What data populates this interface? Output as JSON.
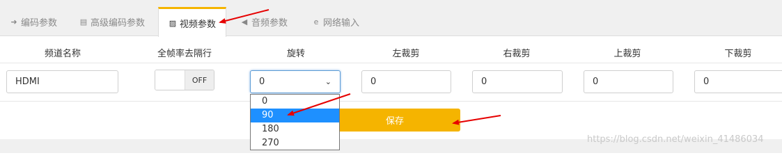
{
  "tabs": [
    {
      "label": "编码参数",
      "icon": "sign-in-icon",
      "glyph": "➜",
      "active": false
    },
    {
      "label": "高级编码参数",
      "icon": "file-icon",
      "glyph": "▤",
      "active": false
    },
    {
      "label": "视频参数",
      "icon": "image-icon",
      "glyph": "▨",
      "active": true
    },
    {
      "label": "音频参数",
      "icon": "volume-icon",
      "glyph": "◀",
      "active": false
    },
    {
      "label": "网络输入",
      "icon": "ie-icon",
      "glyph": "e",
      "active": false
    }
  ],
  "columns": {
    "channel_name": "频道名称",
    "deinterlace": "全帧率去隔行",
    "rotate": "旋转",
    "crop_left": "左裁剪",
    "crop_right": "右裁剪",
    "crop_top": "上裁剪",
    "crop_bottom": "下裁剪"
  },
  "fields": {
    "channel_name": "HDMI",
    "deinterlace_state": "OFF",
    "rotate_selected": "0",
    "crop_left": "0",
    "crop_right": "0",
    "crop_top": "0",
    "crop_bottom": "0"
  },
  "rotate_options": [
    "0",
    "90",
    "180",
    "270"
  ],
  "highlighted_option": "90",
  "save_label": "保存",
  "watermark": "https://blog.csdn.net/weixin_41486034",
  "colors": {
    "accent": "#f5b400",
    "selected_option": "#1e90ff",
    "annotation_arrow": "#e60000"
  }
}
